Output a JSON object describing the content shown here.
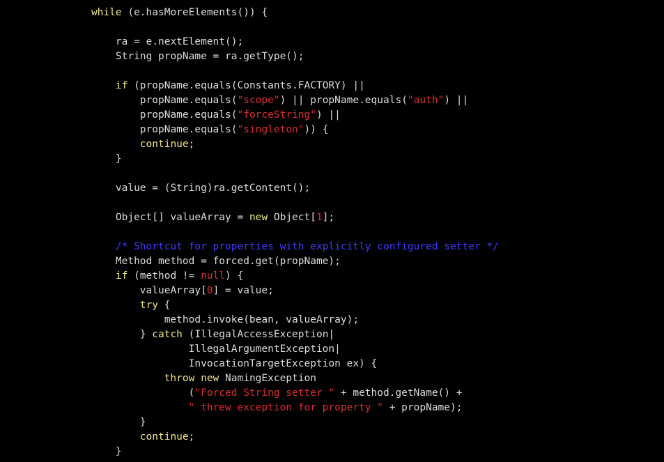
{
  "code": {
    "indent1": "               ",
    "indent2": "                   ",
    "indent3": "                       ",
    "indent4": "                           ",
    "indent5": "                               ",
    "indent6": "                                   ",
    "kw_while": "while",
    "kw_if": "if",
    "kw_continue": "continue",
    "kw_new": "new",
    "kw_try": "try",
    "kw_catch": "catch",
    "kw_throw": "throw",
    "kw_null": "null",
    "l1_a": " (e.hasMoreElements()) {",
    "l2": "ra = e.nextElement();",
    "l3": "String propName = ra.getType();",
    "l4_a": " (propName.equals(Constants.FACTORY) ||",
    "l5_a": "propName.equals(",
    "l5_s": "\"scope\"",
    "l5_b": ") || propName.equals(",
    "l5_s2": "\"auth\"",
    "l5_c": ") ||",
    "l6_a": "propName.equals(",
    "l6_s": "\"forceString\"",
    "l6_b": ") ||",
    "l7_a": "propName.equals(",
    "l7_s": "\"singleton\"",
    "l7_b": ")) {",
    "l8_a": ";",
    "l9": "}",
    "l10": "value = (String)ra.getContent();",
    "l11_a": "Object[] valueArray = ",
    "l11_b": " Object[",
    "l11_n": "1",
    "l11_c": "];",
    "l12": "/* Shortcut for properties with explicitly configured setter */",
    "l13": "Method method = forced.get(propName);",
    "l14_a": " (method != ",
    "l14_b": ") {",
    "l15_a": "valueArray[",
    "l15_n": "0",
    "l15_b": "] = value;",
    "l16_a": " {",
    "l17": "method.invoke(bean, valueArray);",
    "l18_a": "} ",
    "l18_b": " (IllegalAccessException|",
    "l19": "IllegalArgumentException|",
    "l20": "InvocationTargetException ex) {",
    "l21_b": " NamingException",
    "l22_a": "(",
    "l22_s": "\"Forced String setter \"",
    "l22_b": " + method.getName() +",
    "l23_s": "\" threw exception for property \"",
    "l23_b": " + propName);",
    "l24": "}",
    "l25_a": ";",
    "l26": "}"
  }
}
